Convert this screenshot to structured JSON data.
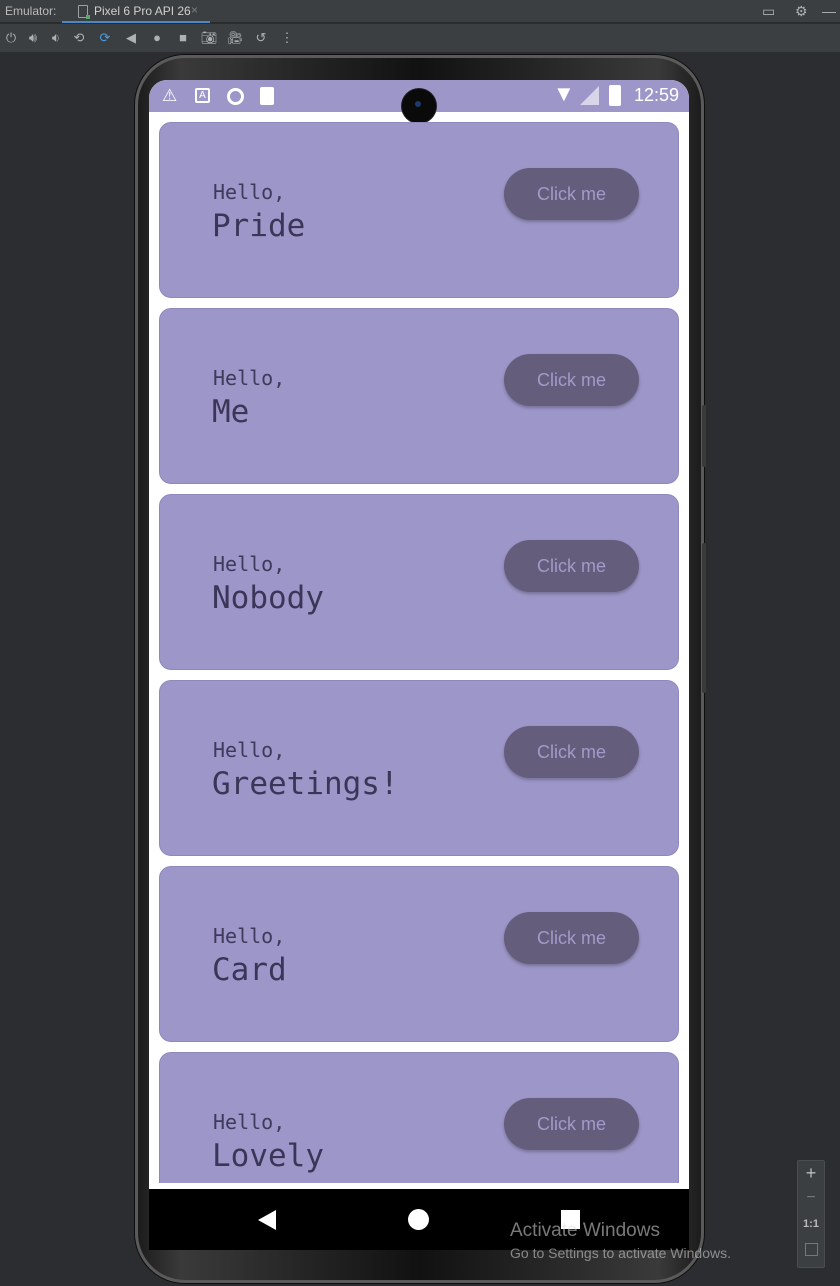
{
  "ide": {
    "panel_label": "Emulator:",
    "device_tab": "Pixel 6 Pro API 26",
    "tab_close": "×"
  },
  "toolbar": {
    "icons": [
      "power-icon",
      "volume-up-icon",
      "volume-down-icon",
      "rotate-left-icon",
      "rotate-right-icon",
      "back-icon",
      "home-icon",
      "overview-icon",
      "screenshot-icon",
      "record-icon",
      "snapshot-icon",
      "more-icon"
    ]
  },
  "device": {
    "status_bar": {
      "time": "12:59",
      "color": "#9d96c9"
    },
    "cards": [
      {
        "greeting": "Hello,",
        "name": "Pride",
        "button": "Click me"
      },
      {
        "greeting": "Hello,",
        "name": "Me",
        "button": "Click me"
      },
      {
        "greeting": "Hello,",
        "name": "Nobody",
        "button": "Click me"
      },
      {
        "greeting": "Hello,",
        "name": "Greetings!",
        "button": "Click me"
      },
      {
        "greeting": "Hello,",
        "name": "Card",
        "button": "Click me"
      },
      {
        "greeting": "Hello,",
        "name": "Lovely",
        "button": "Click me"
      }
    ],
    "card_color": "#9d97c9",
    "button_color": "#655d7c"
  },
  "watermark": {
    "title": "Activate Windows",
    "subtitle": "Go to Settings to activate Windows."
  },
  "zoom": {
    "plus": "+",
    "minus": "−",
    "actual": "1:1"
  }
}
